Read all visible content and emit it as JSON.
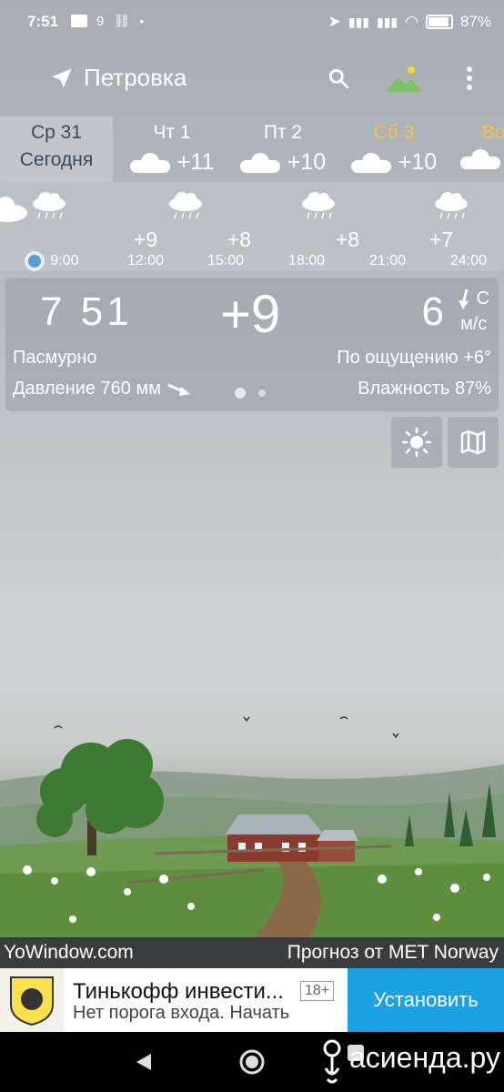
{
  "status": {
    "time": "7:51",
    "battery": "87%",
    "notif_num": "9"
  },
  "location": {
    "city": "Петровка"
  },
  "days": [
    {
      "name": "Ср 31",
      "sub": "Сегодня",
      "temp": "",
      "selected": true
    },
    {
      "name": "Чт 1",
      "temp": "+11"
    },
    {
      "name": "Пт 2",
      "temp": "+10"
    },
    {
      "name": "Сб 3",
      "temp": "+10"
    },
    {
      "name": "Во",
      "temp": ""
    }
  ],
  "hourly": {
    "temps": [
      "+9",
      "+8",
      "+8",
      "+7"
    ],
    "times": [
      "9:00",
      "12:00",
      "15:00",
      "18:00",
      "21:00",
      "24:00"
    ]
  },
  "current": {
    "time": "7 51",
    "temp": "+9",
    "wind_speed": "6",
    "wind_dir": "С",
    "wind_unit": "м/с",
    "condition": "Пасмурно",
    "feels_like": "По ощущению +6°",
    "pressure": "Давление 760 мм",
    "humidity": "Влажность 87%"
  },
  "credit": {
    "left": "YoWindow.com",
    "right": "Прогноз от MET Norway"
  },
  "ad": {
    "title": "Тинькофф инвести...",
    "age": "18+",
    "subtitle": "Нет порога входа. Начать",
    "button": "Установить"
  },
  "watermark": "асиенда.ру"
}
